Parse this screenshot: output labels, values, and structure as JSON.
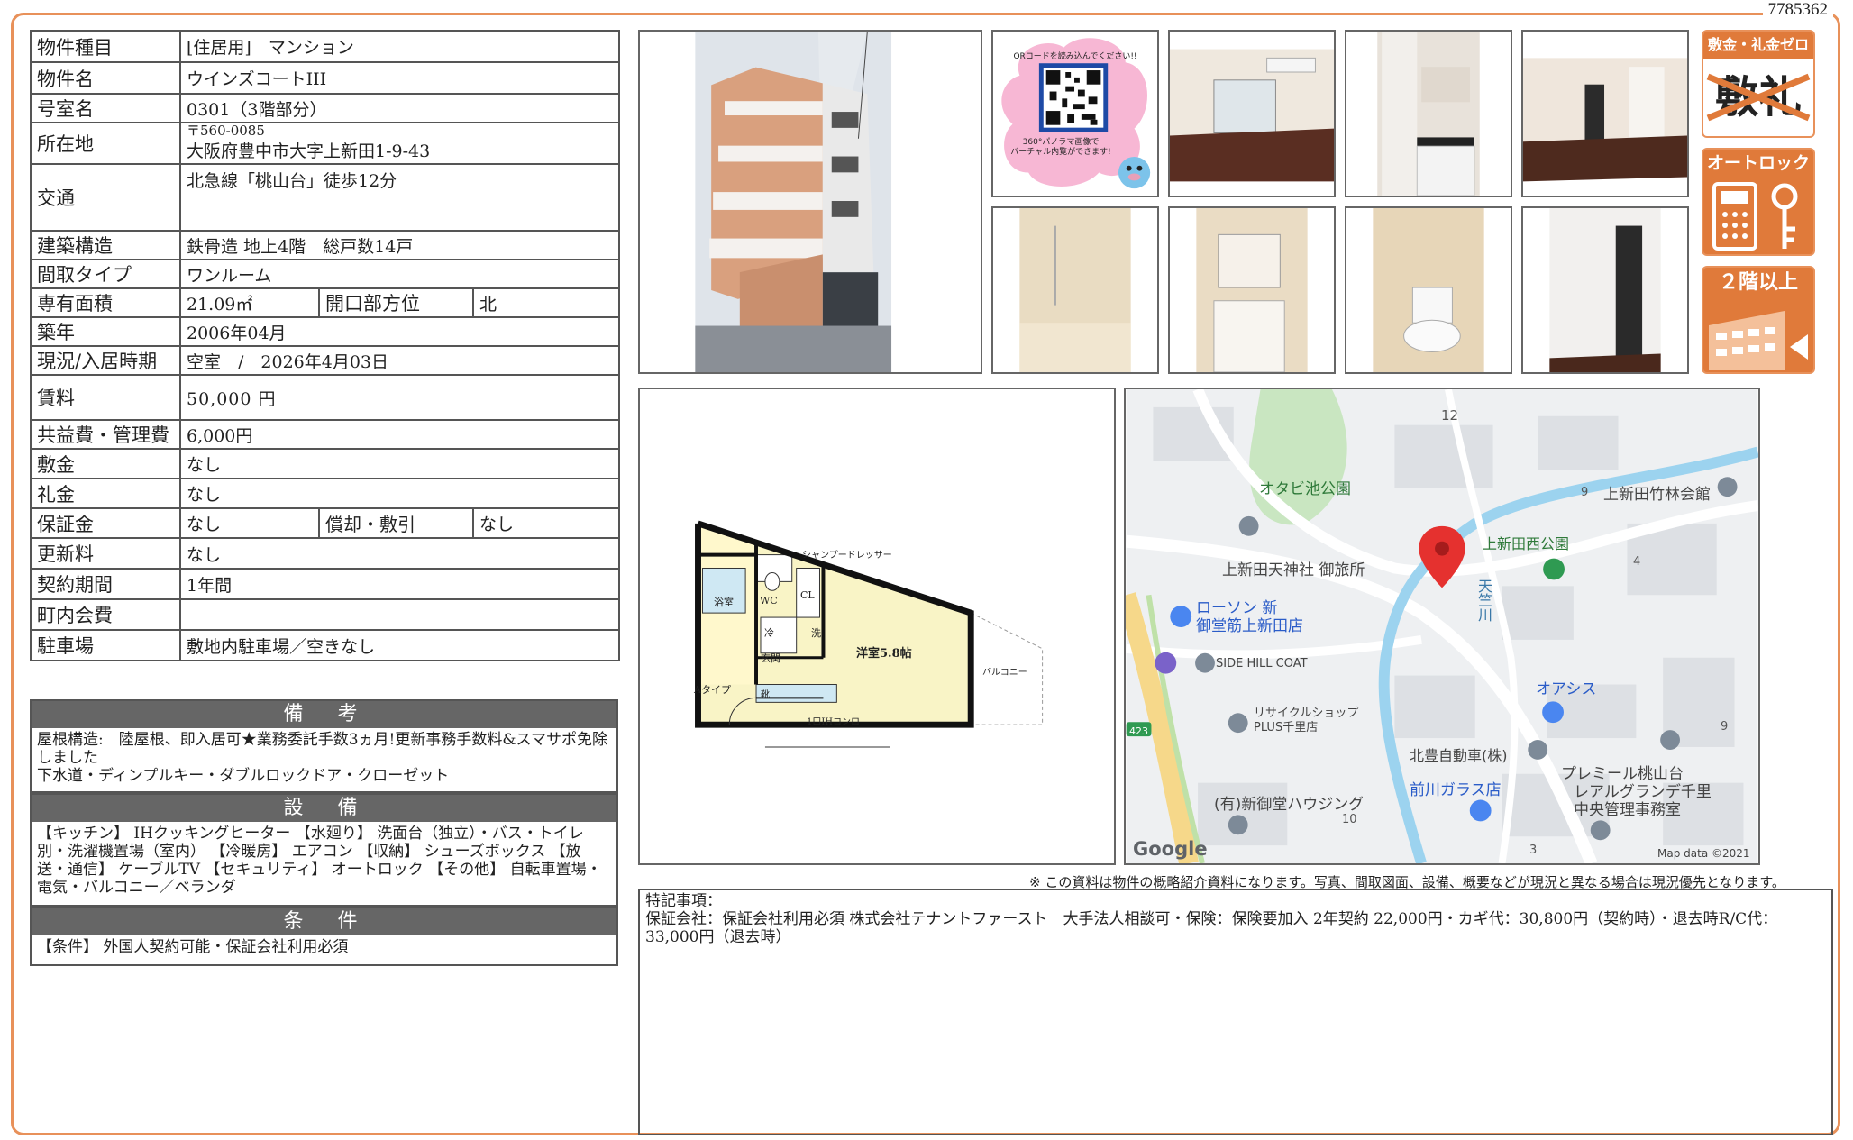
{
  "doc_number": "7785362",
  "spec": {
    "type_label": "物件種目",
    "type_value": "[住居用]　マンション",
    "name_label": "物件名",
    "name_value": "ウインズコートIII",
    "room_label": "号室名",
    "room_value": "0301（3階部分）",
    "address_label": "所在地",
    "postal": "〒560-0085",
    "address_value": "大阪府豊中市大字上新田1-9-43",
    "traffic_label": "交通",
    "traffic_value": "北急線「桃山台」徒歩12分",
    "structure_label": "建築構造",
    "structure_value": "鉄骨造 地上4階　総戸数14戸",
    "layout_label": "間取タイプ",
    "layout_value": "ワンルーム",
    "area_label": "専有面積",
    "area_value": "21.09㎡",
    "opening_label": "開口部方位",
    "opening_value": "北",
    "built_label": "築年",
    "built_value": "2006年04月",
    "status_label": "現況/入居時期",
    "status_value": "空室　/　2026年4月03日",
    "rent_label": "賃料",
    "rent_value": "50,000 円",
    "common_label": "共益費・管理費",
    "common_value": "6,000円",
    "deposit_label": "敷金",
    "deposit_value": "なし",
    "key_label": "礼金",
    "key_value": "なし",
    "guarantee_label": "保証金",
    "guarantee_value": "なし",
    "amort_label": "償却・敷引",
    "amort_value": "なし",
    "renewal_label": "更新料",
    "renewal_value": "なし",
    "contract_label": "契約期間",
    "contract_value": "1年間",
    "town_label": "町内会費",
    "town_value": "",
    "parking_label": "駐車場",
    "parking_value": "敷地内駐車場／空きなし"
  },
  "notes": {
    "title": "備　考",
    "line1": "屋根構造:　陸屋根、即入居可★業務委託手数3ヵ月!更新事務手数料&スマサポ免除しました",
    "line2": "下水道・ディンプルキー・ダブルロックドア・クローゼット"
  },
  "equipment": {
    "title": "設　備",
    "text": "【キッチン】 IHクッキングヒーター 【水廻り】 洗面台（独立）・バス・トイレ別・洗濯機置場（室内） 【冷暖房】 エアコン 【収納】 シューズボックス 【放送・通信】 ケーブルTV 【セキュリティ】 オートロック 【その他】 自転車置場・電気・バルコニー／ベランダ"
  },
  "conditions": {
    "title": "条　件",
    "text": "【条件】 外国人契約可能・保証会社利用必須"
  },
  "qr": {
    "top": "QRコードを読み込んでください!!",
    "bottom1": "360°パノラマ画像で",
    "bottom2": "バーチャル内覧ができます!"
  },
  "badges": {
    "deposit_zero": "敷金・礼金ゼロ",
    "deposit_glyph1": "敷",
    "deposit_glyph2": "礼",
    "autolock": "オートロック",
    "floor2": "２階以上"
  },
  "floorplan": {
    "shoe_dresser": "シャンプードレッサー",
    "wc": "WC",
    "bath": "浴室",
    "cl": "CL",
    "room": "洋室5.8帖",
    "entrance": "玄関",
    "balcony": "バルコニー",
    "type": "Aタイプ",
    "kitchen": "1口IHコンロ",
    "wash": "洗",
    "cold": "冷",
    "shoes": "靴"
  },
  "map": {
    "num12": "12",
    "park1": "オタビ池公園",
    "num9a": "9",
    "hall": "上新田竹林会館",
    "shrine": "上新田天神社 御旅所",
    "park2": "上新田西公園",
    "num4": "4",
    "river": "天竺川",
    "lawson1": "ローソン 新",
    "lawson2": "御堂筋上新田店",
    "sidehill": "SIDE HILL COAT",
    "oasis": "オアシス",
    "recycle1": "リサイクルショップ",
    "recycle2": "PLUS千里店",
    "num9b": "9",
    "route": "423",
    "kitahoyo": "北豊自動車(株)",
    "premiere1": "プレミール桃山台",
    "premiere2": "レアルグランデ千里",
    "premiere3": "中央管理事務室",
    "glass": "前川ガラス店",
    "housing": "(有)新御堂ハウジング",
    "num10": "10",
    "num3": "3",
    "google": "Google",
    "mapdata": "Map data ©2021"
  },
  "footnote": "※ この資料は物件の概略紹介資料になります。写真、間取図面、設備、概要などが現況と異なる場合は現況優先となります。",
  "remarks": {
    "title": "特記事項：",
    "text": "保証会社：保証会社利用必須 株式会社テナントファースト　大手法人相談可・保険：保険要加入 2年契約 22,000円・カギ代：30,800円（契約時）・退去時R/C代：33,000円（退去時）"
  }
}
